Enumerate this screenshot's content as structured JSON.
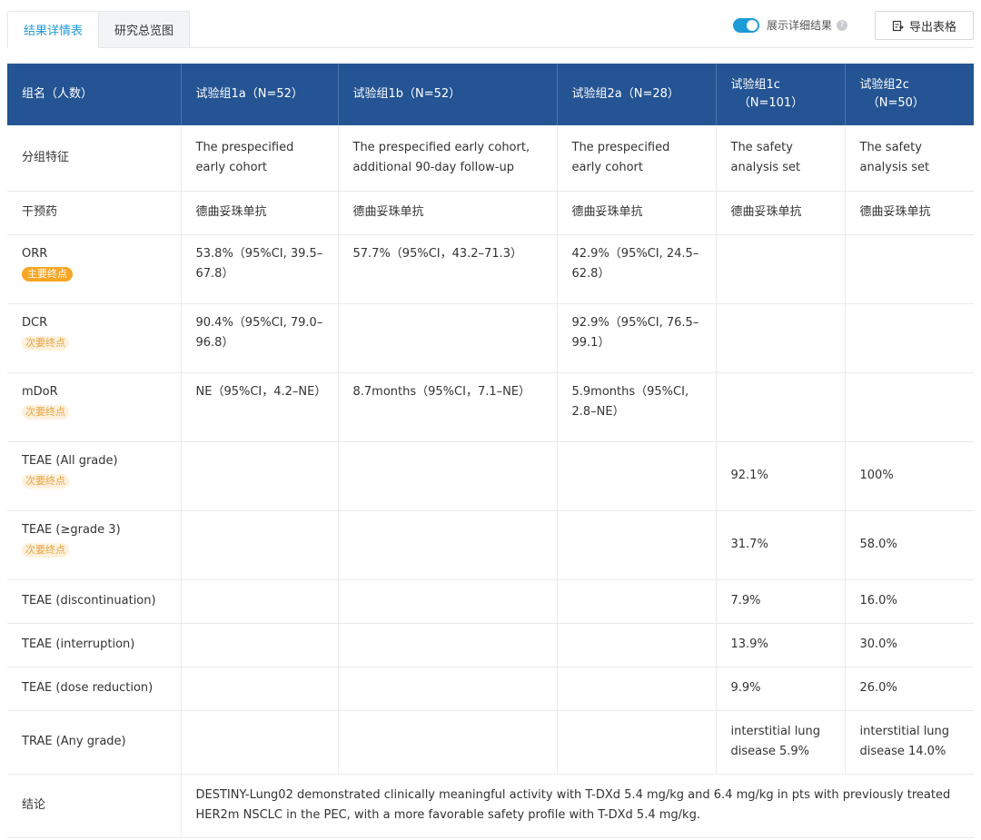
{
  "tabs": [
    {
      "label": "结果详情表",
      "active": true
    },
    {
      "label": "研究总览图",
      "active": false
    }
  ],
  "toggle": {
    "label": "展示详细结果",
    "on": true
  },
  "export_label": "导出表格",
  "colors": {
    "header_bg": "#245493",
    "accent": "#1d9bd7",
    "primary_badge": "#f6a623",
    "secondary_badge_text": "#e9a23b"
  },
  "table": {
    "header": {
      "label": "组名（人数）",
      "groups": [
        "试验组1a（N=52）",
        "试验组1b（N=52）",
        "试验组2a（N=28）",
        "试验组1c\n（N=101）",
        "试验组2c\n（N=50）"
      ]
    },
    "rows": [
      {
        "label": "分组特征",
        "badge": "",
        "cells": [
          "The prespecified early cohort",
          "The prespecified early cohort, additional 90-day follow-up",
          "The prespecified early cohort",
          "The safety analysis set",
          "The safety analysis set"
        ]
      },
      {
        "label": "干预药",
        "badge": "",
        "cells": [
          "德曲妥珠单抗",
          "德曲妥珠单抗",
          "德曲妥珠单抗",
          "德曲妥珠单抗",
          "德曲妥珠单抗"
        ]
      },
      {
        "label": "ORR",
        "badge": "主要终点",
        "cells": [
          "53.8%（95%CI, 39.5–67.8）",
          "57.7%（95%CI，43.2–71.3）",
          "42.9%（95%CI, 24.5–62.8）",
          "",
          ""
        ]
      },
      {
        "label": "DCR",
        "badge": "次要终点",
        "cells": [
          "90.4%（95%CI, 79.0–96.8）",
          "",
          "92.9%（95%CI, 76.5–99.1）",
          "",
          ""
        ]
      },
      {
        "label": "mDoR",
        "badge": "次要终点",
        "cells": [
          "NE（95%CI，4.2–NE）",
          "8.7months（95%CI，7.1–NE）",
          "5.9months（95%CI, 2.8–NE）",
          "",
          ""
        ]
      },
      {
        "label": "TEAE (All grade)",
        "badge": "次要终点",
        "cells": [
          "",
          "",
          "",
          "92.1%",
          "100%"
        ]
      },
      {
        "label": "TEAE (≥grade 3)",
        "badge": "次要终点",
        "cells": [
          "",
          "",
          "",
          "31.7%",
          "58.0%"
        ]
      },
      {
        "label": "TEAE (discontinuation)",
        "badge": "",
        "cells": [
          "",
          "",
          "",
          "7.9%",
          "16.0%"
        ]
      },
      {
        "label": "TEAE (interruption)",
        "badge": "",
        "cells": [
          "",
          "",
          "",
          "13.9%",
          "30.0%"
        ]
      },
      {
        "label": "TEAE (dose reduction)",
        "badge": "",
        "cells": [
          "",
          "",
          "",
          "9.9%",
          "26.0%"
        ]
      },
      {
        "label": "TRAE (Any grade)",
        "badge": "",
        "cells": [
          "",
          "",
          "",
          "interstitial lung disease 5.9%",
          "interstitial lung disease 14.0%"
        ]
      }
    ],
    "conclusion": {
      "label": "结论",
      "text": "DESTINY-Lung02 demonstrated clinically meaningful activity with T-DXd 5.4 mg/kg and 6.4 mg/kg in pts with previously treated HER2m NSCLC in the PEC, with a more favorable safety profile with T-DXd 5.4 mg/kg."
    }
  }
}
